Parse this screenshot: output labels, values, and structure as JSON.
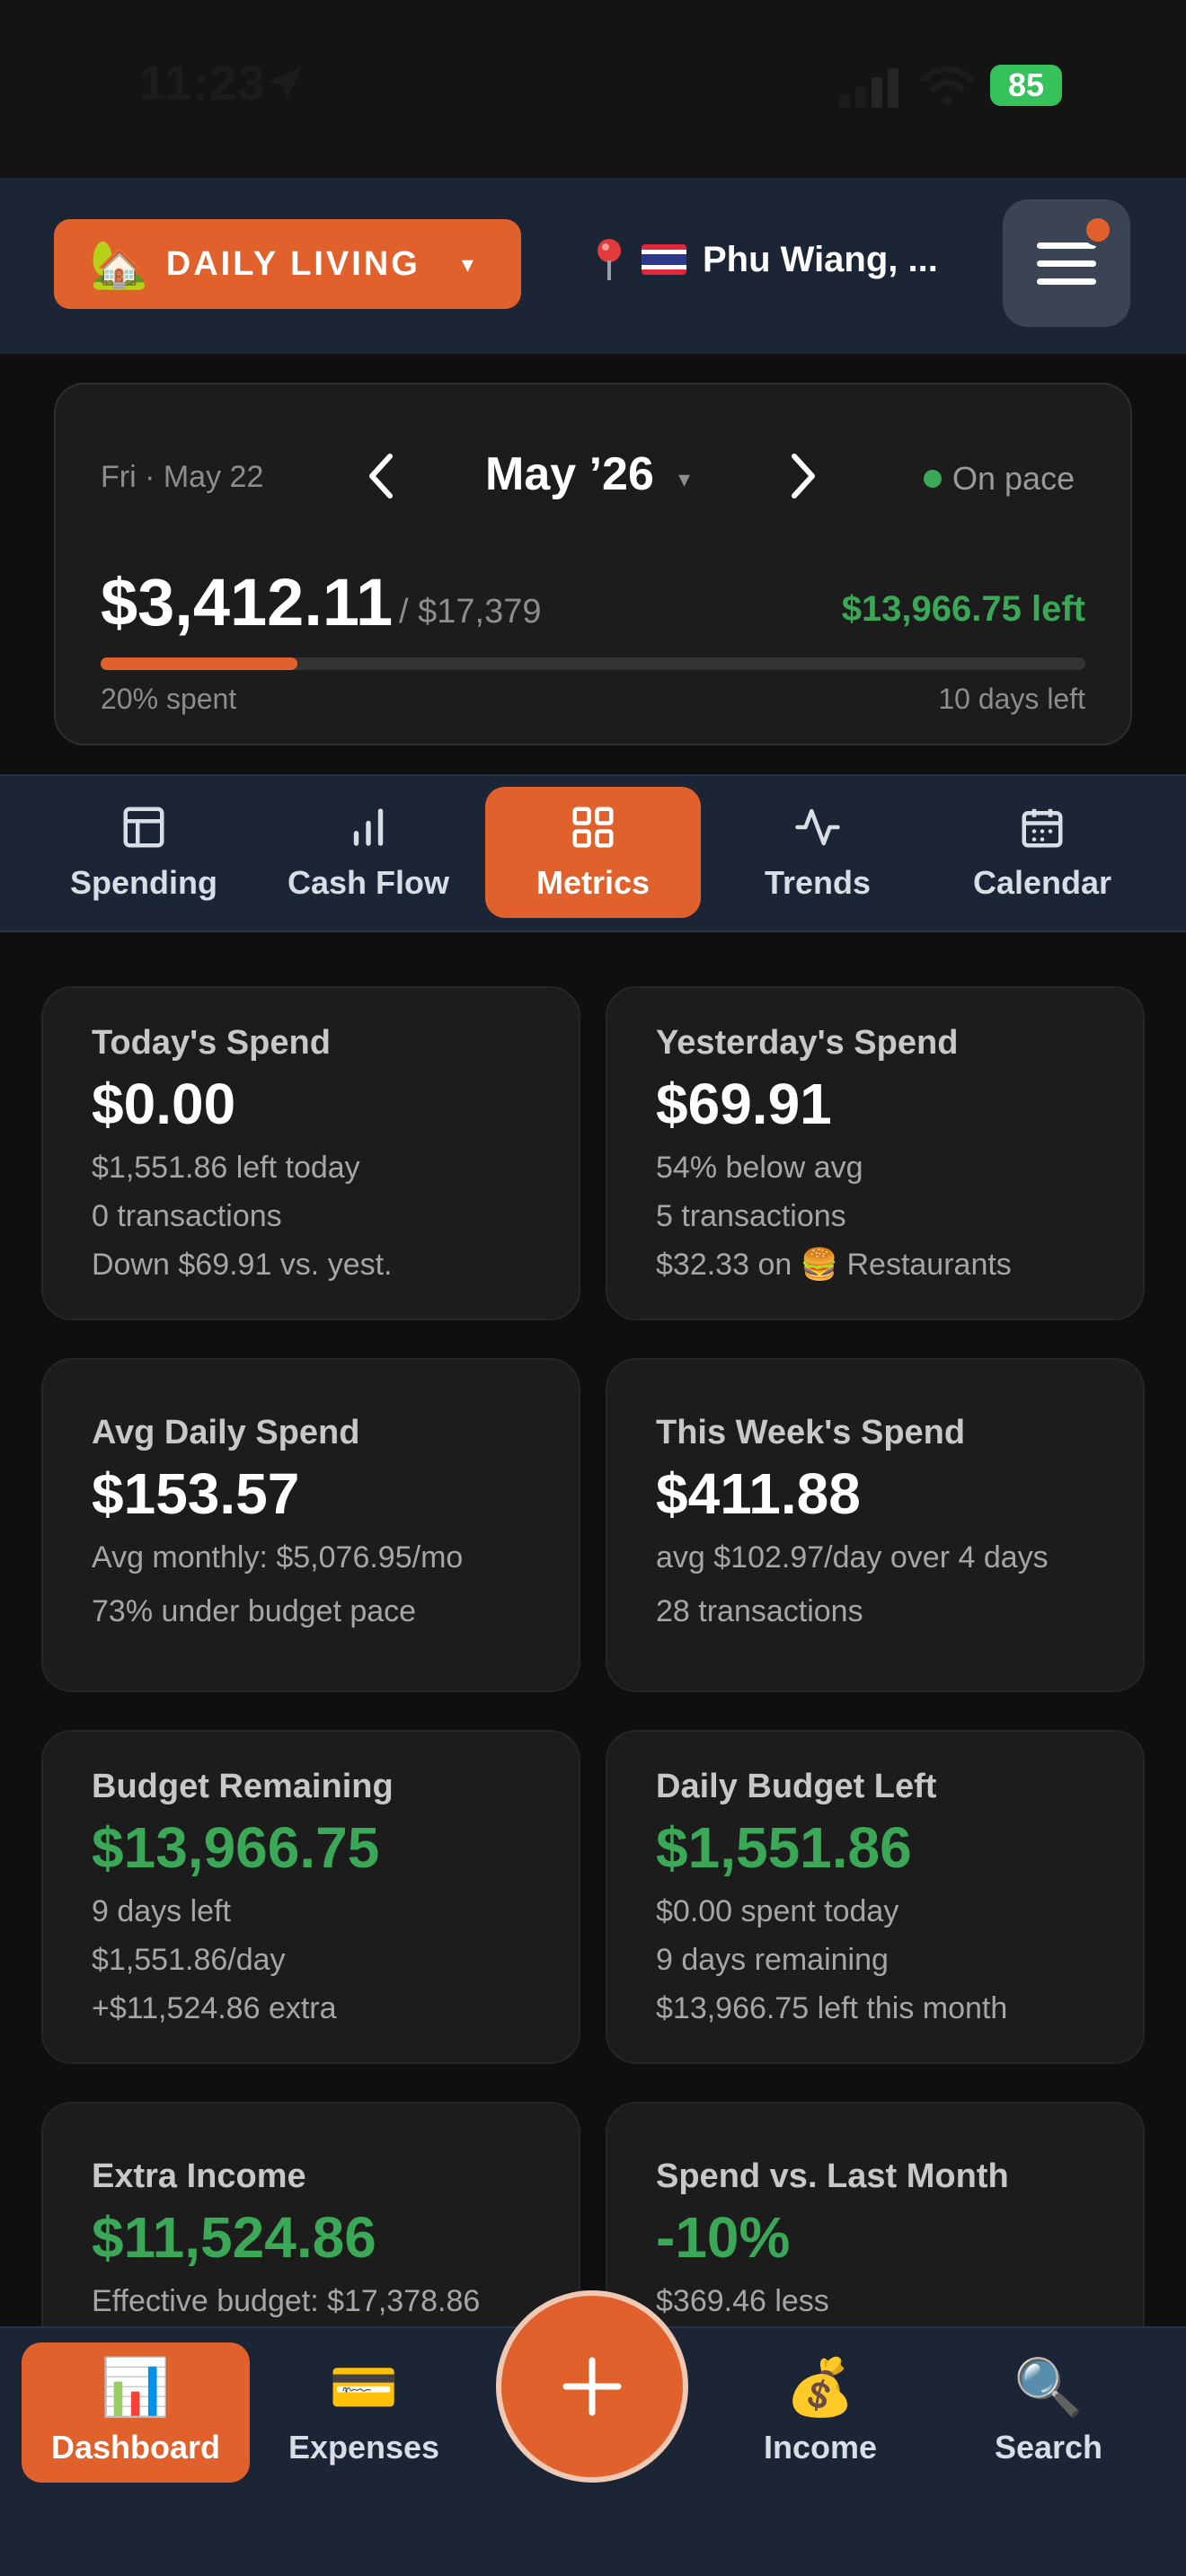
{
  "status_bar": {
    "time": "11:23",
    "battery": "85"
  },
  "header": {
    "context_emoji": "🏡",
    "context_label": "DAILY LIVING",
    "context_caret": "▾",
    "location_text": "Phu Wiang, ..."
  },
  "month_card": {
    "date": "Fri · May 22",
    "month": "May ’26",
    "month_caret": "▾",
    "pace_status": "On pace",
    "spent": "$3,412.11",
    "budget": "/ $17,379",
    "left": "$13,966.75 left",
    "progress_fraction": 0.2,
    "spent_pct": "20% spent",
    "days_left": "10 days left"
  },
  "tabs": [
    {
      "label": "Spending",
      "icon": "layout-icon"
    },
    {
      "label": "Cash Flow",
      "icon": "bar-chart-icon"
    },
    {
      "label": "Metrics",
      "icon": "grid-icon",
      "active": true
    },
    {
      "label": "Trends",
      "icon": "activity-icon"
    },
    {
      "label": "Calendar",
      "icon": "calendar-icon"
    }
  ],
  "metrics": [
    {
      "title": "Today's Spend",
      "value": "$0.00",
      "lines": [
        "$1,551.86 left today",
        "0 transactions",
        "Down $69.91 vs. yest."
      ]
    },
    {
      "title": "Yesterday's Spend",
      "value": "$69.91",
      "lines": [
        "54% below avg",
        "5 transactions",
        "$32.33 on 🍔 Restaurants"
      ]
    },
    {
      "title": "Avg Daily Spend",
      "value": "$153.57",
      "lines": [
        "Avg monthly: $5,076.95/mo",
        "73% under budget pace"
      ]
    },
    {
      "title": "This Week's Spend",
      "value": "$411.88",
      "lines": [
        "avg $102.97/day over 4 days",
        "28 transactions"
      ]
    },
    {
      "title": "Budget Remaining",
      "value": "$13,966.75",
      "lines": [
        "9 days left",
        "$1,551.86/day",
        "+$11,524.86 extra"
      ]
    },
    {
      "title": "Daily Budget Left",
      "value": "$1,551.86",
      "lines": [
        "$0.00 spent today",
        "9 days remaining",
        "$13,966.75 left this month"
      ]
    },
    {
      "title": "Extra Income",
      "value": "$11,524.86",
      "lines": [
        "Effective budget: $17,378.86"
      ]
    },
    {
      "title": "Spend vs. Last Month",
      "value": "-10%",
      "lines": [
        "$369.46 less"
      ]
    }
  ],
  "bottom_nav": [
    {
      "label": "Dashboard",
      "emoji": "📊",
      "active": true
    },
    {
      "label": "Expenses",
      "emoji": "💳"
    },
    {
      "label": "Income",
      "emoji": "💰"
    },
    {
      "label": "Search",
      "emoji": "🔍"
    }
  ],
  "colors": {
    "accent": "#e0612b",
    "positive": "#3aa857",
    "header_bg": "#1c2535",
    "card_bg": "#1c1c1c"
  }
}
